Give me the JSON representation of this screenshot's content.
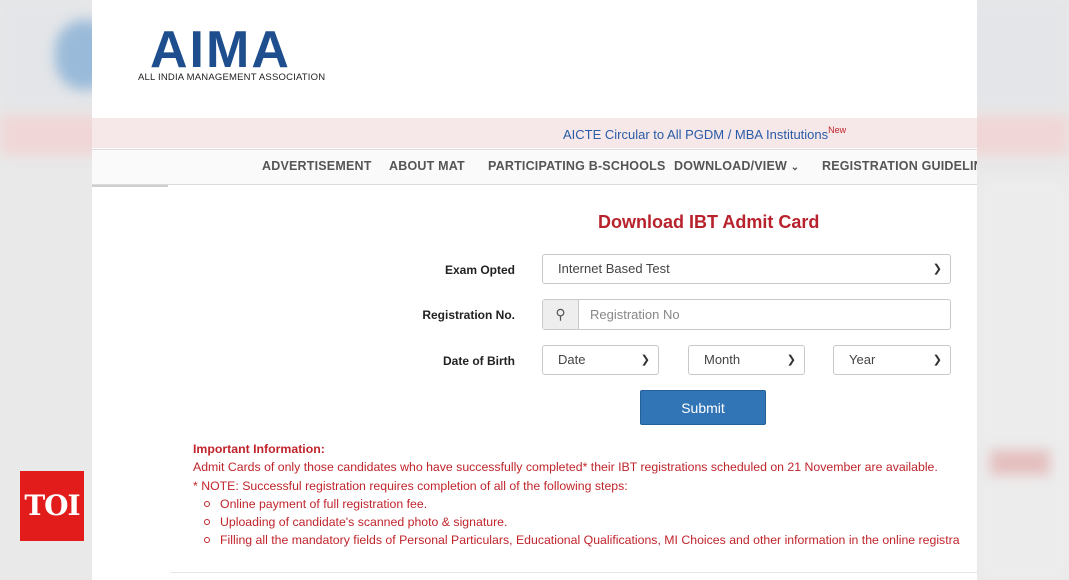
{
  "logo": {
    "letters": "AIMA",
    "subtitle": "ALL INDIA MANAGEMENT ASSOCIATION"
  },
  "announcement": {
    "text": "AICTE Circular to All PGDM / MBA Institutions",
    "badge": "New"
  },
  "nav": {
    "items": [
      "ADVERTISEMENT",
      "ABOUT MAT",
      "PARTICIPATING B-SCHOOLS",
      "DOWNLOAD/VIEW",
      "REGISTRATION GUIDELINES"
    ]
  },
  "form": {
    "title": "Download IBT Admit Card",
    "exam_label": "Exam Opted",
    "exam_value": "Internet Based Test",
    "registration_label": "Registration No.",
    "registration_placeholder": "Registration No",
    "dob_label": "Date of Birth",
    "date_value": "Date",
    "month_value": "Month",
    "year_value": "Year",
    "submit_label": "Submit"
  },
  "info": {
    "heading": "Important Information:",
    "line1": "Admit Cards of only those candidates who have successfully completed* their IBT registrations scheduled on 21 November are available.",
    "line2": "* NOTE: Successful registration requires completion of all of the following steps:",
    "steps": [
      "Online payment of full registration fee.",
      "Uploading of candidate's scanned photo & signature.",
      "Filling all the mandatory fields of Personal Particulars, Educational Qualifications, MI Choices and other information in the online registra"
    ]
  },
  "watermark": {
    "text": "TOI",
    "color": "#e21b1b"
  },
  "colors": {
    "brand": "#1f4e8f",
    "accent_red": "#c0242b",
    "button": "#3175b7"
  }
}
